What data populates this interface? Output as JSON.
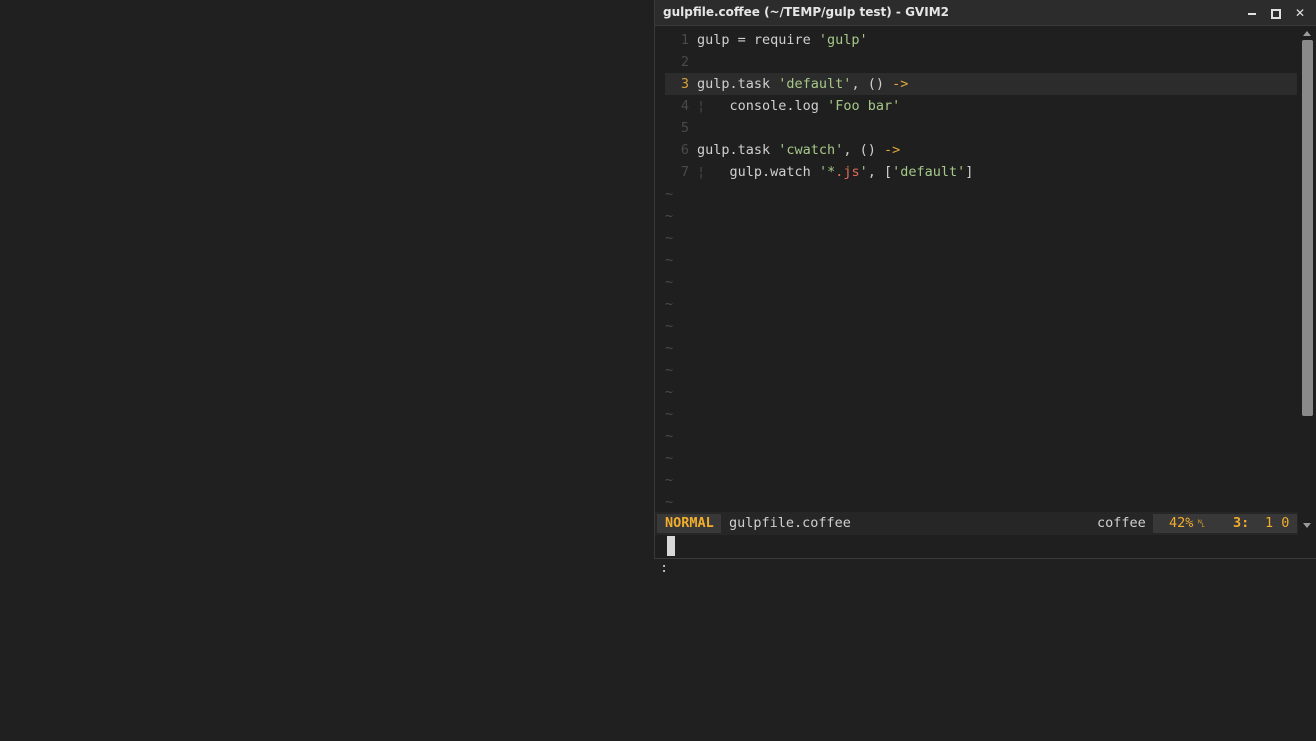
{
  "window": {
    "title": "gulpfile.coffee (~/TEMP/gulp test) - GVIM2",
    "controls": {
      "minimize_icon": "minimize-icon",
      "maximize_icon": "maximize-icon",
      "close_label": "✕"
    }
  },
  "editor": {
    "current_line": 3,
    "lines": [
      {
        "num": "1",
        "tokens": [
          {
            "t": "gulp = require ",
            "c": "code"
          },
          {
            "t": "'gulp'",
            "c": "str"
          }
        ]
      },
      {
        "num": "2",
        "tokens": []
      },
      {
        "num": "3",
        "tokens": [
          {
            "t": "gulp.task ",
            "c": "code"
          },
          {
            "t": "'default'",
            "c": "str"
          },
          {
            "t": ", () ",
            "c": "code"
          },
          {
            "t": "->",
            "c": "op"
          }
        ]
      },
      {
        "num": "4",
        "tokens": [
          {
            "t": "¦",
            "c": "indent-guide"
          },
          {
            "t": "   console.log ",
            "c": "code"
          },
          {
            "t": "'Foo bar'",
            "c": "str"
          }
        ]
      },
      {
        "num": "5",
        "tokens": []
      },
      {
        "num": "6",
        "tokens": [
          {
            "t": "gulp.task ",
            "c": "code"
          },
          {
            "t": "'cwatch'",
            "c": "str"
          },
          {
            "t": ", () ",
            "c": "code"
          },
          {
            "t": "->",
            "c": "op"
          }
        ]
      },
      {
        "num": "7",
        "tokens": [
          {
            "t": "¦",
            "c": "indent-guide"
          },
          {
            "t": "   gulp.watch ",
            "c": "code"
          },
          {
            "t": "'*",
            "c": "str"
          },
          {
            "t": ".js",
            "c": "strsp"
          },
          {
            "t": "'",
            "c": "str"
          },
          {
            "t": ", [",
            "c": "code"
          },
          {
            "t": "'default'",
            "c": "str"
          },
          {
            "t": "]",
            "c": "code"
          }
        ]
      }
    ],
    "tilde": "~",
    "tilde_count": 15
  },
  "statusline": {
    "mode": "NORMAL",
    "filename": "gulpfile.coffee",
    "filetype": "coffee",
    "percent": "42%",
    "line_icon": "␤",
    "line": "3:",
    "col": "1 0"
  },
  "cmdline": {
    "prompt": ":"
  },
  "colors": {
    "background": "#1f1f1f",
    "accent": "#f3ad2c",
    "string": "#a6c98a",
    "operator": "#e2a83c"
  }
}
